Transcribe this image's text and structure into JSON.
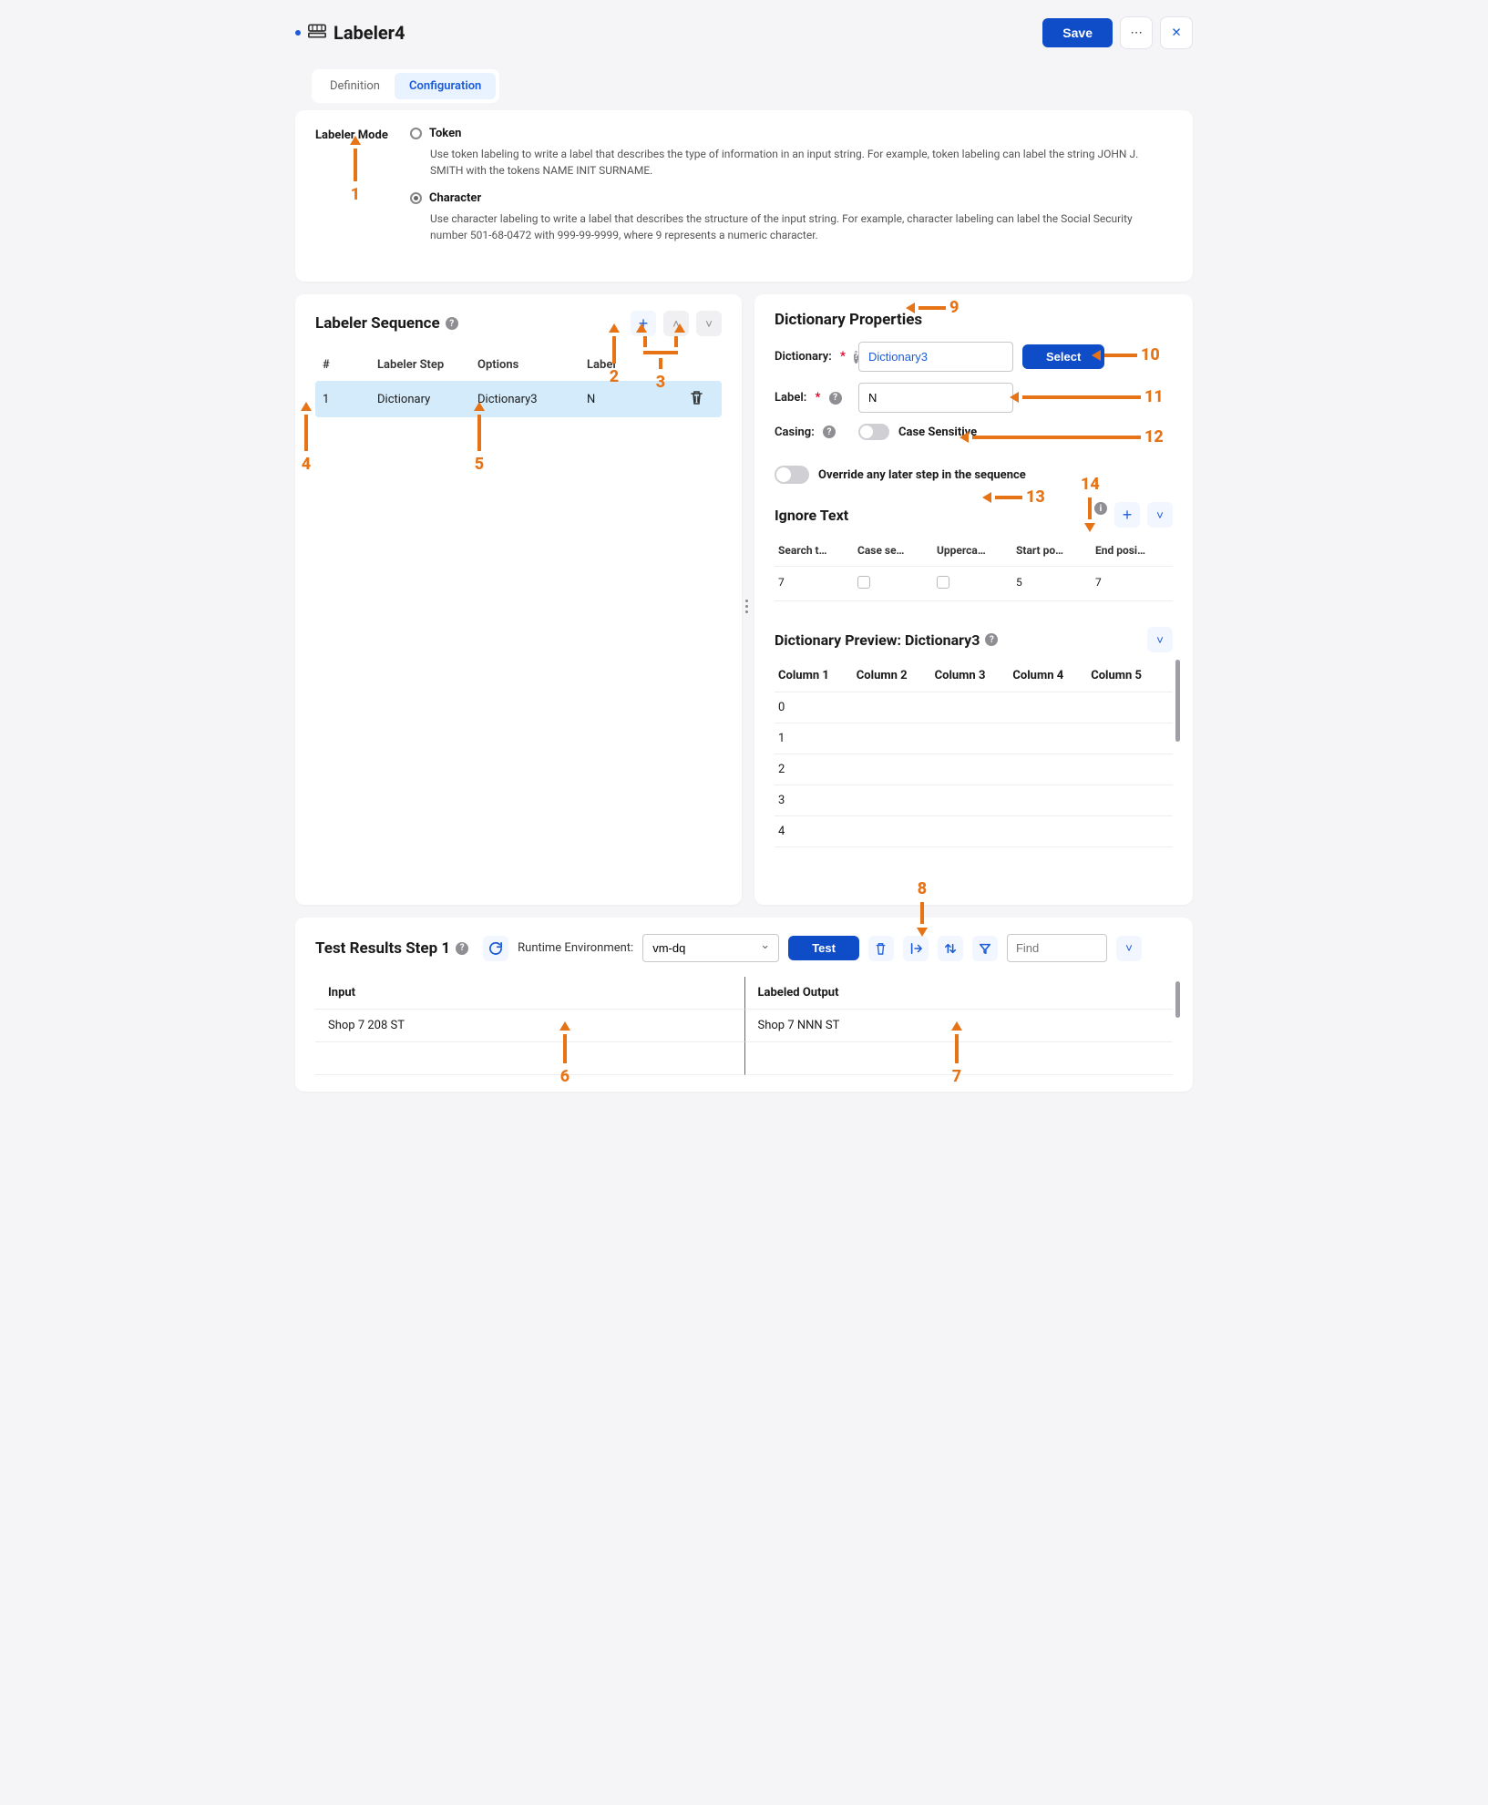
{
  "header": {
    "title": "Labeler4",
    "save": "Save"
  },
  "tabs": {
    "definition": "Definition",
    "configuration": "Configuration"
  },
  "labelerMode": {
    "label": "Labeler Mode",
    "token": {
      "name": "Token",
      "desc": "Use token labeling to write a label that describes the type of information in an input string. For example, token labeling can label the string JOHN J. SMITH with the tokens NAME INIT SURNAME."
    },
    "character": {
      "name": "Character",
      "desc": "Use character labeling to write a label that describes the structure of the input string. For example, character labeling can label the Social Security number 501-68-0472 with 999-99-9999, where 9 represents a numeric character."
    }
  },
  "sequence": {
    "title": "Labeler Sequence",
    "cols": {
      "num": "#",
      "step": "Labeler Step",
      "options": "Options",
      "label": "Label"
    },
    "row": {
      "num": "1",
      "step": "Dictionary",
      "options": "Dictionary3",
      "label": "N"
    }
  },
  "props": {
    "title": "Dictionary Properties",
    "dictionary_label": "Dictionary:",
    "dictionary_value": "Dictionary3",
    "select_btn": "Select",
    "label_label": "Label:",
    "label_value": "N",
    "casing_label": "Casing:",
    "casing_value": "Case Sensitive",
    "override_label": "Override any later step in the sequence",
    "ignore_title": "Ignore Text",
    "ignore_cols": {
      "search": "Search t…",
      "case": "Case se…",
      "upper": "Upperca…",
      "start": "Start po…",
      "end": "End posi…"
    },
    "ignore_row": {
      "search": "7",
      "start": "5",
      "end": "7"
    },
    "preview_title": "Dictionary Preview: Dictionary3",
    "preview_cols": [
      "Column 1",
      "Column 2",
      "Column 3",
      "Column 4",
      "Column 5"
    ],
    "preview_rows": [
      "0",
      "1",
      "2",
      "3",
      "4"
    ]
  },
  "test": {
    "title": "Test Results Step 1",
    "runtime_label": "Runtime Environment:",
    "runtime_value": "vm-dq",
    "test_btn": "Test",
    "find_placeholder": "Find",
    "cols": {
      "input": "Input",
      "output": "Labeled Output"
    },
    "row": {
      "input": "Shop 7 208  ST",
      "output": "Shop 7 NNN  ST"
    }
  },
  "annotations": {
    "a1": "1",
    "a2": "2",
    "a3": "3",
    "a4": "4",
    "a5": "5",
    "a6": "6",
    "a7": "7",
    "a8": "8",
    "a9": "9",
    "a10": "10",
    "a11": "11",
    "a12": "12",
    "a13": "13",
    "a14": "14"
  }
}
